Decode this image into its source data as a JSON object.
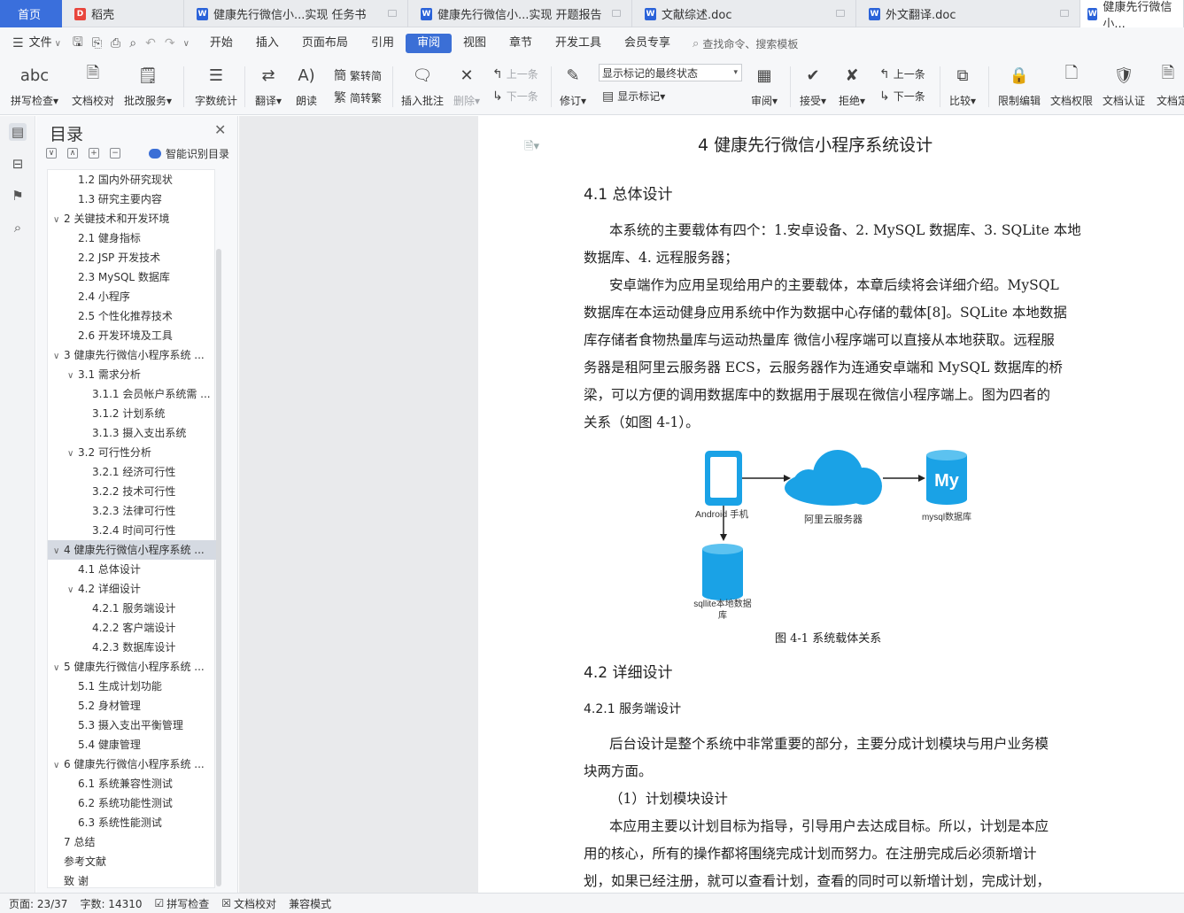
{
  "tabs": {
    "home": "首页",
    "t1": "稻壳",
    "t2": "健康先行微信小...实现 任务书",
    "t3": "健康先行微信小...实现 开题报告",
    "t4": "文献综述.doc",
    "t5": "外文翻译.doc",
    "t6": "健康先行微信小..."
  },
  "menu": [
    "文件",
    "开始",
    "插入",
    "页面布局",
    "引用",
    "审阅",
    "视图",
    "章节",
    "开发工具",
    "会员专享"
  ],
  "search_placeholder": "查找命令、搜索模板",
  "ribbon": {
    "spell": "拼写检查",
    "proof": "文档校对",
    "batch": "批改服务",
    "wordcount": "字数统计",
    "translate": "翻译",
    "read": "朗读",
    "t2s": "繁转简",
    "s2t": "简转繁",
    "insert_comment": "插入批注",
    "delete": "删除",
    "prev": "上一条",
    "next": "下一条",
    "track": "修订",
    "markup_select": "显示标记的最终状态",
    "show_markup": "显示标记",
    "review": "审阅",
    "accept": "接受",
    "reject": "拒绝",
    "prev2": "上一条",
    "next2": "下一条",
    "compare": "比较",
    "restrict": "限制编辑",
    "permission": "文档权限",
    "certify": "文档认证",
    "doc_more": "文档定"
  },
  "nav": {
    "title": "目录",
    "smart": "智能识别目录",
    "items": [
      {
        "t": "1.2 国内外研究现状",
        "lv": 2
      },
      {
        "t": "1.3 研究主要内容",
        "lv": 2
      },
      {
        "t": "2 关键技术和开发环境",
        "lv": 1,
        "arr": "∨"
      },
      {
        "t": "2.1 健身指标",
        "lv": 2
      },
      {
        "t": "2.2 JSP 开发技术",
        "lv": 2
      },
      {
        "t": "2.3 MySQL 数据库",
        "lv": 2
      },
      {
        "t": "2.4 小程序",
        "lv": 2
      },
      {
        "t": "2.5 个性化推荐技术",
        "lv": 2
      },
      {
        "t": "2.6 开发环境及工具",
        "lv": 2
      },
      {
        "t": "3 健康先行微信小程序系统 ...",
        "lv": 1,
        "arr": "∨"
      },
      {
        "t": "3.1 需求分析",
        "lv": 2,
        "arr": "∨"
      },
      {
        "t": "3.1.1 会员帐户系统需 ...",
        "lv": 3
      },
      {
        "t": "3.1.2 计划系统",
        "lv": 3
      },
      {
        "t": "3.1.3 摄入支出系统",
        "lv": 3
      },
      {
        "t": "3.2 可行性分析",
        "lv": 2,
        "arr": "∨"
      },
      {
        "t": "3.2.1 经济可行性",
        "lv": 3
      },
      {
        "t": "3.2.2 技术可行性",
        "lv": 3
      },
      {
        "t": "3.2.3 法律可行性",
        "lv": 3
      },
      {
        "t": "3.2.4 时间可行性",
        "lv": 3
      },
      {
        "t": "4 健康先行微信小程序系统 ...",
        "lv": 1,
        "arr": "∨",
        "sel": true
      },
      {
        "t": "4.1 总体设计",
        "lv": 2
      },
      {
        "t": "4.2 详细设计",
        "lv": 2,
        "arr": "∨"
      },
      {
        "t": "4.2.1 服务端设计",
        "lv": 3
      },
      {
        "t": "4.2.2 客户端设计",
        "lv": 3
      },
      {
        "t": "4.2.3 数据库设计",
        "lv": 3
      },
      {
        "t": "5 健康先行微信小程序系统 ...",
        "lv": 1,
        "arr": "∨"
      },
      {
        "t": "5.1 生成计划功能",
        "lv": 2
      },
      {
        "t": "5.2 身材管理",
        "lv": 2
      },
      {
        "t": "5.3 摄入支出平衡管理",
        "lv": 2
      },
      {
        "t": "5.4 健康管理",
        "lv": 2
      },
      {
        "t": "6 健康先行微信小程序系统 ...",
        "lv": 1,
        "arr": "∨"
      },
      {
        "t": "6.1 系统兼容性测试",
        "lv": 2
      },
      {
        "t": "6.2 系统功能性测试",
        "lv": 2
      },
      {
        "t": "6.3 系统性能测试",
        "lv": 2
      },
      {
        "t": "7 总结",
        "lv": 1
      },
      {
        "t": "参考文献",
        "lv": 1
      },
      {
        "t": "致 谢",
        "lv": 1
      }
    ]
  },
  "doc": {
    "chapter": "4  健康先行微信小程序系统设计",
    "h41": "4.1 总体设计",
    "p1a": "本系统的主要载体有四个：1.安卓设备、2. MySQL 数据库、3. SQLite 本地",
    "p1b": "数据库、4. 远程服务器；",
    "p2a": "安卓端作为应用呈现给用户的主要载体，本章后续将会详细介绍。MySQL",
    "p2b": "数据库在本运动健身应用系统中作为数据中心存储的载体[8]。SQLite 本地数据",
    "p2c": "库存储者食物热量库与运动热量库 微信小程序端可以直接从本地获取。远程服",
    "p2d": "务器是租阿里云服务器 ECS，云服务器作为连通安卓端和 MySQL 数据库的桥",
    "p2e": "梁，可以方便的调用数据库中的数据用于展现在微信小程序端上。图为四者的",
    "p2f": "关系（如图 4-1）。",
    "fig": {
      "android": "Android 手机",
      "cloud": "阿里云服务器",
      "mysql": "mysql数据库",
      "my": "My",
      "sqlite1": "sqllite本地数据",
      "sqlite2": "库"
    },
    "caption": "图 4-1 系统载体关系",
    "h42": "4.2 详细设计",
    "h421": "4.2.1 服务端设计",
    "p3a": "后台设计是整个系统中非常重要的部分，主要分成计划模块与用户业务模",
    "p3b": "块两方面。",
    "p4": "（1）计划模块设计",
    "p5a": "本应用主要以计划目标为指导，引导用户去达成目标。所以，计划是本应",
    "p5b": "用的核心，所有的操作都将围绕完成计划而努力。在注册完成后必须新增计",
    "p5c": "划，如果已经注册，就可以查看计划，查看的同时可以新增计划，完成计划，"
  },
  "status": {
    "page": "页面: 23/37",
    "words": "字数: 14310",
    "spell": "拼写检查",
    "proof": "文档校对",
    "compat": "兼容模式"
  },
  "colors": {
    "accent": "#3b6fd6",
    "figure_blue": "#1aa2e6"
  }
}
